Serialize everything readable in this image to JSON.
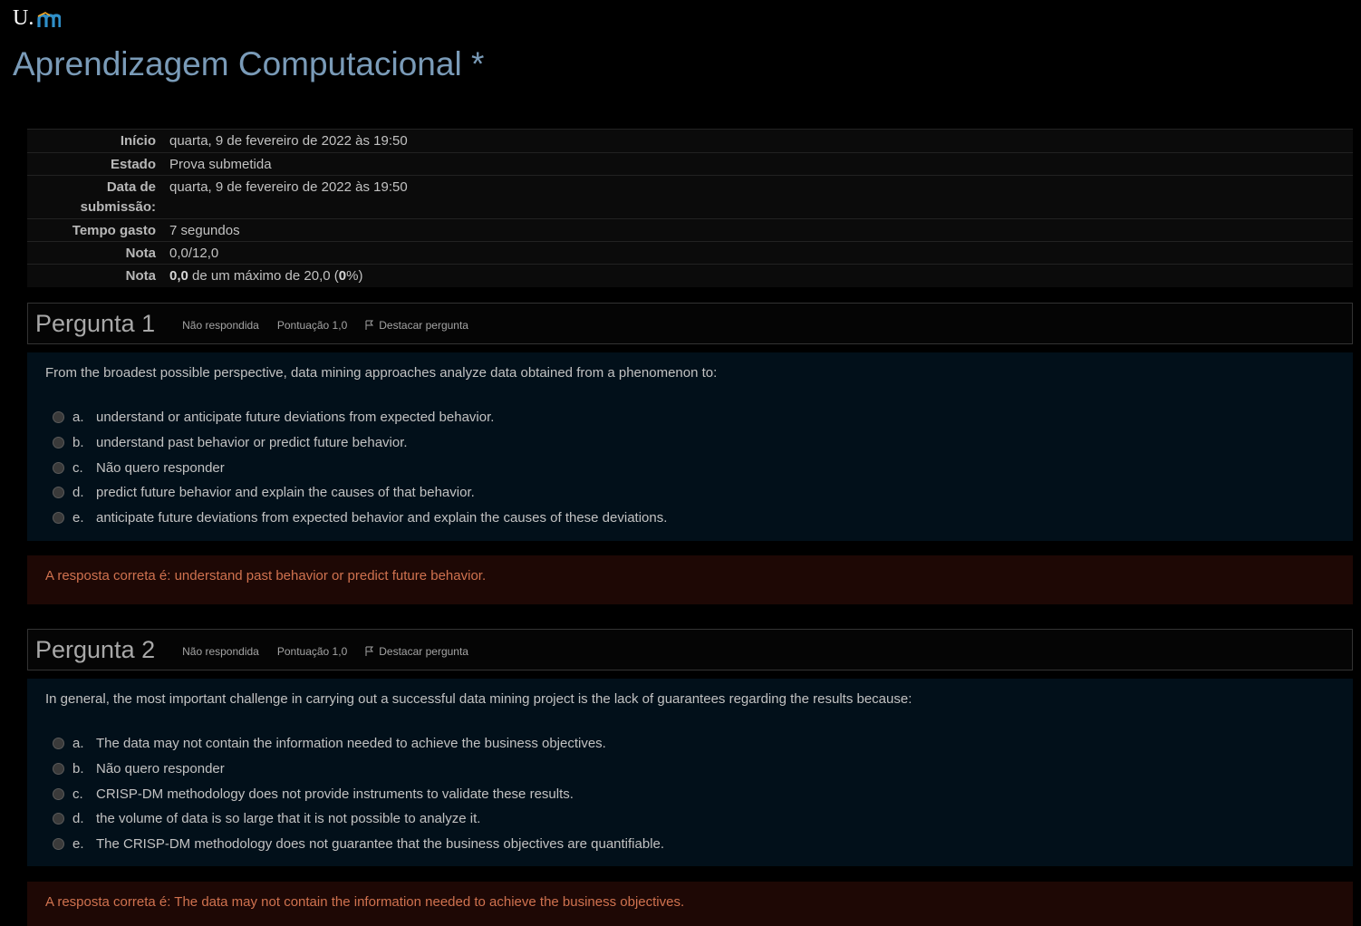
{
  "header": {
    "logo_u": "U.",
    "course_title": "Aprendizagem Computacional *"
  },
  "summary": {
    "rows": [
      {
        "label": "Início",
        "value": "quarta, 9 de fevereiro de 2022 às 19:50"
      },
      {
        "label": "Estado",
        "value": "Prova submetida"
      },
      {
        "label": "Data de submissão:",
        "value": "quarta, 9 de fevereiro de 2022 às 19:50"
      },
      {
        "label": "Tempo gasto",
        "value": "7 segundos"
      },
      {
        "label": "Nota",
        "value": "0,0/12,0"
      },
      {
        "label": "Nota",
        "value_bold_1": "0,0",
        "value_mid": " de um máximo de 20,0 (",
        "value_bold_2": "0",
        "value_end": "%)"
      }
    ]
  },
  "questions": [
    {
      "title": "Pergunta 1",
      "status": "Não respondida",
      "score": "Pontuação 1,0",
      "flag_label": "Destacar pergunta",
      "text": "From the broadest possible perspective, data mining approaches analyze data obtained from a phenomenon to:",
      "answers": [
        {
          "letter": "a.",
          "text": "understand or anticipate future deviations from expected behavior."
        },
        {
          "letter": "b.",
          "text": "understand past behavior or predict future behavior."
        },
        {
          "letter": "c.",
          "text": "Não quero responder"
        },
        {
          "letter": "d.",
          "text": "predict future behavior and explain the causes of that behavior."
        },
        {
          "letter": "e.",
          "text": "anticipate future deviations from expected behavior and explain the causes of these deviations."
        }
      ],
      "feedback": "A resposta correta é: understand past behavior or predict future behavior."
    },
    {
      "title": "Pergunta 2",
      "status": "Não respondida",
      "score": "Pontuação 1,0",
      "flag_label": "Destacar pergunta",
      "text": "In general, the most important challenge in carrying out a successful data mining project is the lack of guarantees regarding the results because:",
      "answers": [
        {
          "letter": "a.",
          "text": "The data may not contain the information needed to achieve the business objectives."
        },
        {
          "letter": "b.",
          "text": "Não quero responder"
        },
        {
          "letter": "c.",
          "text": "CRISP-DM methodology does not provide instruments to validate these results."
        },
        {
          "letter": "d.",
          "text": "the volume of data is so large that it is not possible to analyze it."
        },
        {
          "letter": "e.",
          "text": "The CRISP-DM methodology does not guarantee that the business objectives are quantifiable."
        }
      ],
      "feedback": "A resposta correta é: The data may not contain the information needed to achieve the business objectives."
    }
  ],
  "colors": {
    "title": "#7a9bb8",
    "question_bg": "#02101a",
    "feedback_bg": "#1e0805",
    "feedback_text": "#d0724f",
    "logo_m": "#2f8fc9"
  }
}
